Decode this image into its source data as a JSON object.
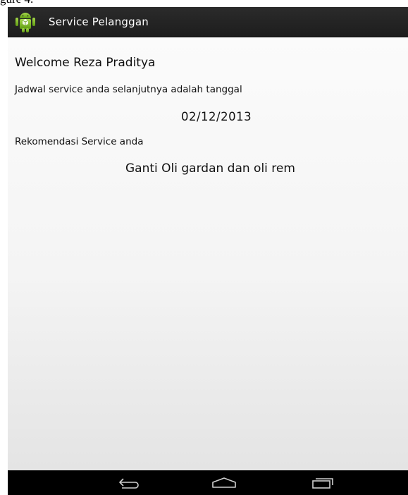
{
  "document_fragment": "gure 4.",
  "app": {
    "title": "Service Pelanggan",
    "icon": "android-robot-icon"
  },
  "content": {
    "welcome": "Welcome Reza Praditya",
    "schedule_label": "Jadwal service anda selanjutnya adalah tanggal",
    "schedule_date": "02/12/2013",
    "recommendation_label": "Rekomendasi Service anda",
    "recommendation_value": "Ganti Oli gardan dan oli rem"
  },
  "navigation": {
    "back_icon": "back-icon",
    "home_icon": "home-icon",
    "recents_icon": "recents-icon"
  },
  "colors": {
    "action_bar": "#1f1f1f",
    "content_background": "#f4f4f4",
    "icon_green": "#7fbf1e"
  }
}
